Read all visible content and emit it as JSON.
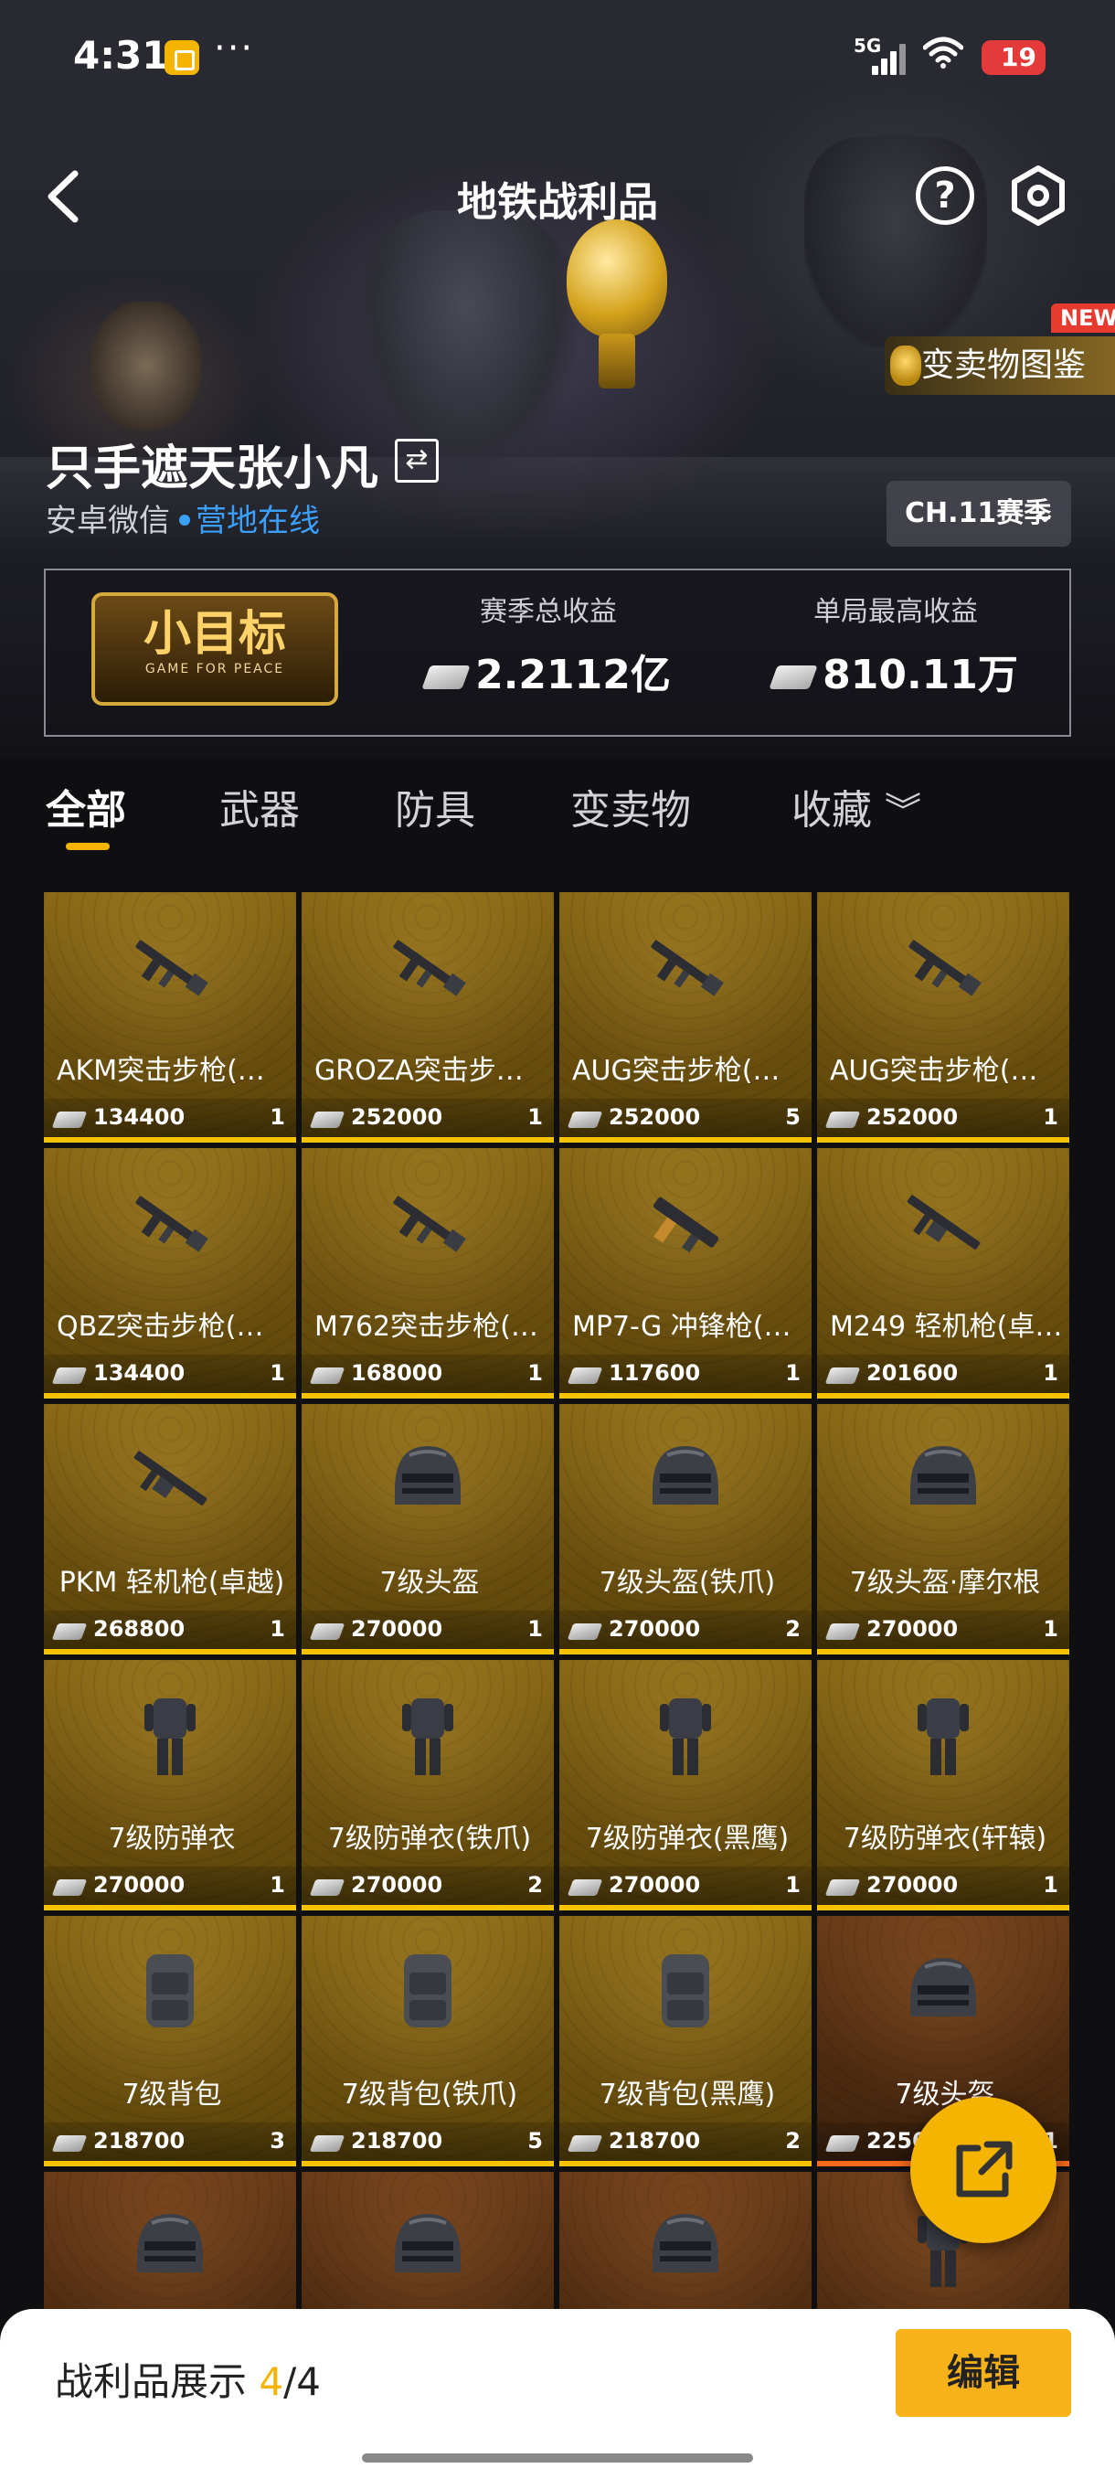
{
  "status_bar": {
    "time": "4:31",
    "dots": "···",
    "network": "5G",
    "battery": "19"
  },
  "nav": {
    "title": "地铁战利品"
  },
  "promo": {
    "new_badge": "NEW",
    "label": "变卖物图鉴"
  },
  "profile": {
    "name": "只手遮天张小凡",
    "platform": "安卓微信",
    "online": "营地在线",
    "season": "CH.11赛季"
  },
  "stats": {
    "badge_title": "小目标",
    "badge_sub": "GAME FOR PEACE",
    "season_total_label": "赛季总收益",
    "season_total_value": "2.2112亿",
    "best_label": "单局最高收益",
    "best_value": "810.11万"
  },
  "tabs": [
    "全部",
    "武器",
    "防具",
    "变卖物",
    "收藏"
  ],
  "items": [
    {
      "name": "AKM突击步枪(…",
      "price": "134400",
      "count": "1",
      "icon": "rifle-icon",
      "align": "left"
    },
    {
      "name": "GROZA突击步…",
      "price": "252000",
      "count": "1",
      "icon": "rifle-icon",
      "align": "left"
    },
    {
      "name": "AUG突击步枪(…",
      "price": "252000",
      "count": "5",
      "icon": "rifle-icon",
      "align": "left"
    },
    {
      "name": "AUG突击步枪(…",
      "price": "252000",
      "count": "1",
      "icon": "rifle-icon",
      "align": "left"
    },
    {
      "name": "QBZ突击步枪(…",
      "price": "134400",
      "count": "1",
      "icon": "rifle-icon",
      "align": "left"
    },
    {
      "name": "M762突击步枪(…",
      "price": "168000",
      "count": "1",
      "icon": "rifle-icon",
      "align": "left"
    },
    {
      "name": "MP7-G 冲锋枪(…",
      "price": "117600",
      "count": "1",
      "icon": "smg-icon",
      "align": "left"
    },
    {
      "name": "M249 轻机枪(卓…",
      "price": "201600",
      "count": "1",
      "icon": "lmg-icon",
      "align": "left"
    },
    {
      "name": "PKM 轻机枪(卓越)",
      "price": "268800",
      "count": "1",
      "icon": "lmg-icon",
      "align": "center"
    },
    {
      "name": "7级头盔",
      "price": "270000",
      "count": "1",
      "icon": "helmet-icon",
      "align": "center"
    },
    {
      "name": "7级头盔(铁爪)",
      "price": "270000",
      "count": "2",
      "icon": "helmet-icon",
      "align": "center"
    },
    {
      "name": "7级头盔·摩尔根",
      "price": "270000",
      "count": "1",
      "icon": "helmet-icon",
      "align": "center"
    },
    {
      "name": "7级防弹衣",
      "price": "270000",
      "count": "1",
      "icon": "armor-icon",
      "align": "center"
    },
    {
      "name": "7级防弹衣(铁爪)",
      "price": "270000",
      "count": "2",
      "icon": "armor-icon",
      "align": "center"
    },
    {
      "name": "7级防弹衣(黑鹰)",
      "price": "270000",
      "count": "1",
      "icon": "armor-icon",
      "align": "center"
    },
    {
      "name": "7级防弹衣(轩辕)",
      "price": "270000",
      "count": "1",
      "icon": "armor-icon",
      "align": "center"
    },
    {
      "name": "7级背包",
      "price": "218700",
      "count": "3",
      "icon": "backpack-icon",
      "align": "center"
    },
    {
      "name": "7级背包(铁爪)",
      "price": "218700",
      "count": "5",
      "icon": "backpack-icon",
      "align": "center"
    },
    {
      "name": "7级背包(黑鹰)",
      "price": "218700",
      "count": "2",
      "icon": "backpack-icon",
      "align": "center"
    },
    {
      "name": "7级头盔",
      "price": "2250",
      "count": "21",
      "icon": "helmet-icon",
      "align": "center",
      "tier": "red"
    },
    {
      "name": "",
      "price": "",
      "count": "",
      "icon": "helmet-icon",
      "align": "center",
      "tier": "red"
    },
    {
      "name": "",
      "price": "",
      "count": "",
      "icon": "helmet-icon",
      "align": "center",
      "tier": "red"
    },
    {
      "name": "",
      "price": "",
      "count": "",
      "icon": "helmet-icon",
      "align": "center",
      "tier": "red"
    },
    {
      "name": "",
      "price": "",
      "count": "",
      "icon": "armor-icon",
      "align": "center",
      "tier": "red"
    }
  ],
  "bottom": {
    "label": "战利品展示",
    "current": "4",
    "total": "/4",
    "edit": "编辑"
  },
  "colors": {
    "accent": "#f5b400",
    "gold_tile": "#7a5c12",
    "red_tile": "#5a3212",
    "online": "#3aa0ff"
  }
}
